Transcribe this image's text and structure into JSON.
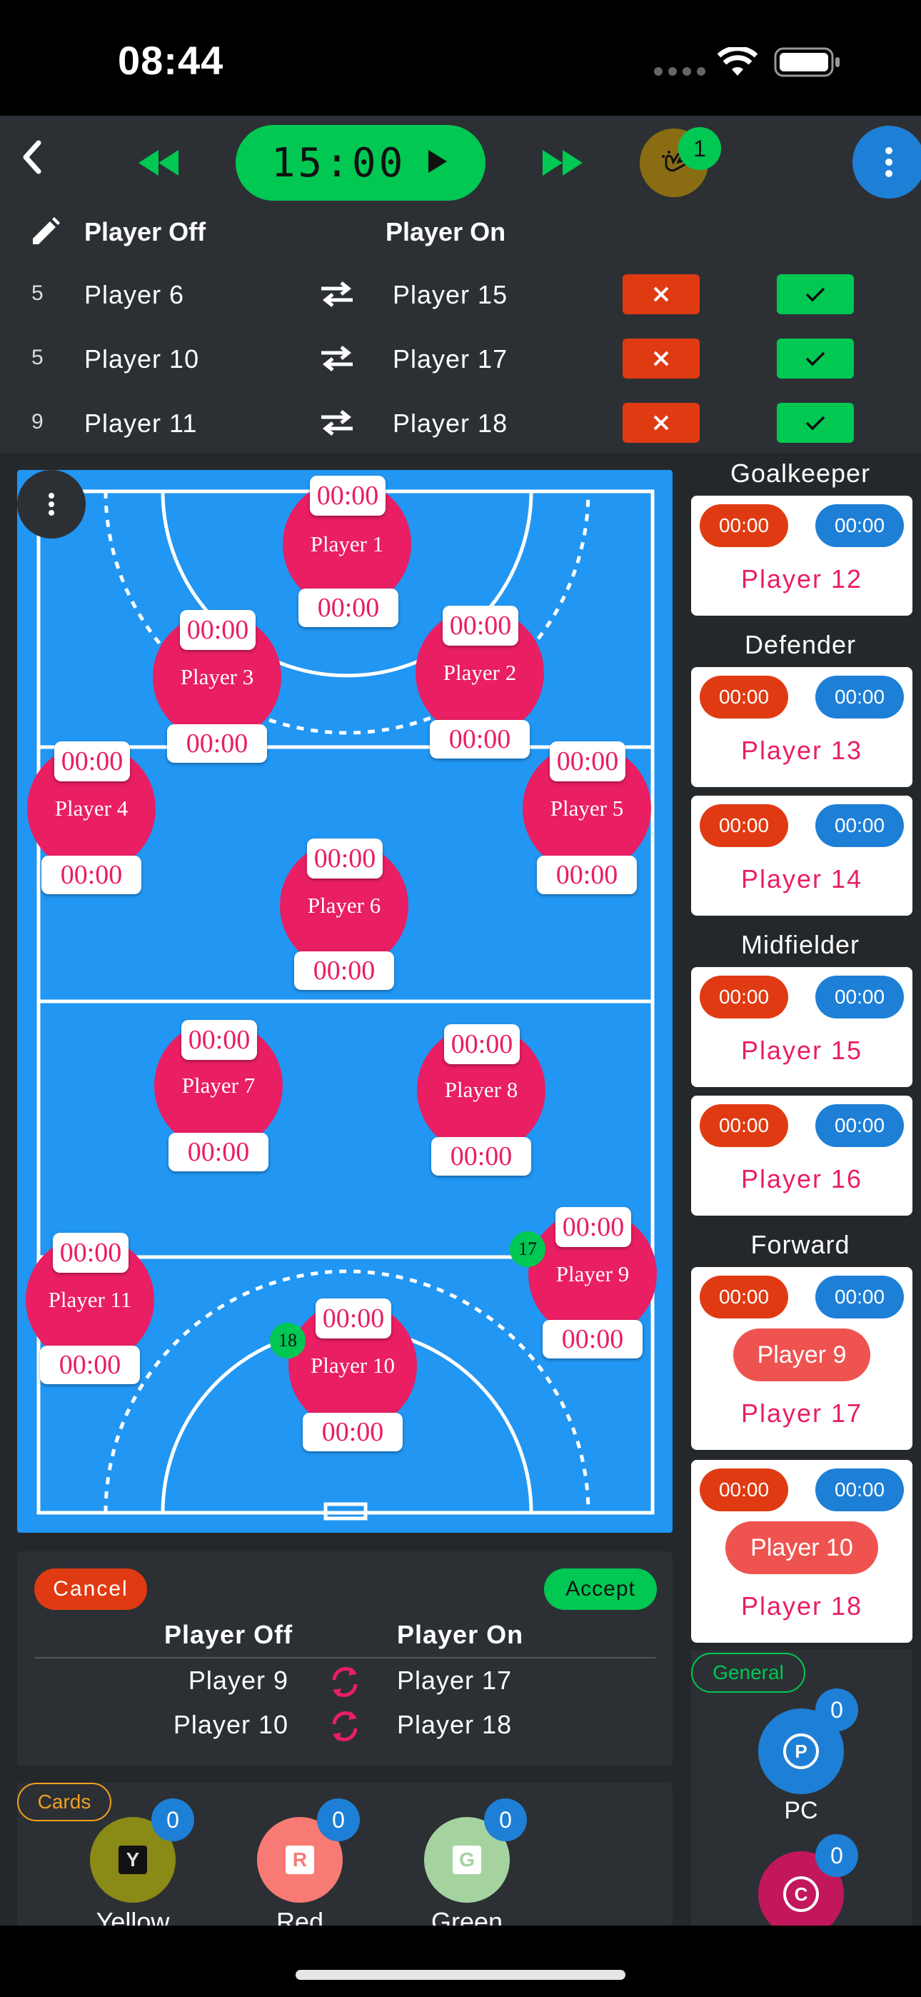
{
  "status_bar": {
    "time": "08:44"
  },
  "top_bar": {
    "timer": "15:00",
    "subs_badge": "1"
  },
  "subs_panel": {
    "header_off": "Player Off",
    "header_on": "Player On",
    "rows": [
      {
        "num": "5",
        "off": "Player 6",
        "on": "Player 15"
      },
      {
        "num": "5",
        "off": "Player 10",
        "on": "Player 17"
      },
      {
        "num": "9",
        "off": "Player 11",
        "on": "Player 18"
      }
    ]
  },
  "court": {
    "players": [
      {
        "name": "Player 1",
        "time_top": "00:00",
        "time_bottom": "00:00"
      },
      {
        "name": "Player 2",
        "time_top": "00:00",
        "time_bottom": "00:00"
      },
      {
        "name": "Player 3",
        "time_top": "00:00",
        "time_bottom": "00:00"
      },
      {
        "name": "Player 4",
        "time_top": "00:00",
        "time_bottom": "00:00"
      },
      {
        "name": "Player 5",
        "time_top": "00:00",
        "time_bottom": "00:00"
      },
      {
        "name": "Player 6",
        "time_top": "00:00",
        "time_bottom": "00:00"
      },
      {
        "name": "Player 7",
        "time_top": "00:00",
        "time_bottom": "00:00"
      },
      {
        "name": "Player 8",
        "time_top": "00:00",
        "time_bottom": "00:00"
      },
      {
        "name": "Player 9",
        "time_top": "00:00",
        "time_bottom": "00:00",
        "pending_num": "17"
      },
      {
        "name": "Player 10",
        "time_top": "00:00",
        "time_bottom": "00:00",
        "pending_num": "18"
      },
      {
        "name": "Player 11",
        "time_top": "00:00",
        "time_bottom": "00:00"
      }
    ]
  },
  "bench": {
    "groups": [
      {
        "title": "Goalkeeper",
        "cards": [
          {
            "red": "00:00",
            "blue": "00:00",
            "name": "Player 12"
          }
        ]
      },
      {
        "title": "Defender",
        "cards": [
          {
            "red": "00:00",
            "blue": "00:00",
            "name": "Player 13"
          },
          {
            "red": "00:00",
            "blue": "00:00",
            "name": "Player 14"
          }
        ]
      },
      {
        "title": "Midfielder",
        "cards": [
          {
            "red": "00:00",
            "blue": "00:00",
            "name": "Player 15"
          },
          {
            "red": "00:00",
            "blue": "00:00",
            "name": "Player 16"
          }
        ]
      },
      {
        "title": "Forward",
        "cards": [
          {
            "red": "00:00",
            "blue": "00:00",
            "chip": "Player 9",
            "name": "Player 17"
          },
          {
            "red": "00:00",
            "blue": "00:00",
            "chip": "Player 10",
            "name": "Player 18"
          }
        ]
      }
    ]
  },
  "pending": {
    "cancel": "Cancel",
    "accept": "Accept",
    "header_off": "Player Off",
    "header_on": "Player On",
    "rows": [
      {
        "off": "Player 9",
        "on": "Player 17"
      },
      {
        "off": "Player 10",
        "on": "Player 18"
      }
    ]
  },
  "cards": {
    "label": "Cards",
    "items": [
      {
        "letter": "Y",
        "label": "Yellow",
        "count": "0",
        "color": "#8a8a16"
      },
      {
        "letter": "R",
        "label": "Red",
        "count": "0",
        "color": "#f77b74"
      },
      {
        "letter": "G",
        "label": "Green",
        "count": "0",
        "color": "#a4d3a0"
      }
    ]
  },
  "general": {
    "label": "General",
    "items": [
      {
        "letter": "P",
        "label": "PC",
        "count": "0",
        "color": "#1e7fd6"
      },
      {
        "letter": "C",
        "label": "",
        "count": "0",
        "color": "#c2185b"
      }
    ]
  },
  "colors": {
    "accent_green": "#00c853",
    "court_blue": "#2196f3",
    "player_pink": "#e91e63",
    "cancel_red": "#e03a12",
    "badge_blue": "#1e7fd6"
  }
}
